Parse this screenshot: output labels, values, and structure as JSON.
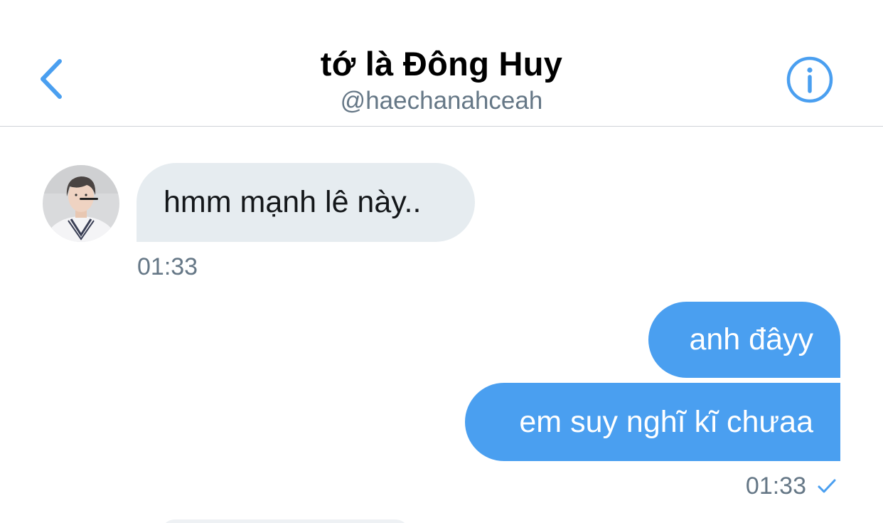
{
  "header": {
    "title": "tớ là Đông Huy",
    "handle": "@haechanahceah"
  },
  "messages": [
    {
      "direction": "incoming",
      "text": "hmm mạnh lê này..",
      "time": "01:33"
    },
    {
      "direction": "outgoing",
      "text": "anh đâyy"
    },
    {
      "direction": "outgoing",
      "text": "em suy nghĩ kĩ chưaa",
      "time": "01:33"
    }
  ],
  "colors": {
    "accent": "#4a9ff0",
    "incoming_bubble": "#e6ecf0",
    "secondary_text": "#657786"
  },
  "icons": {
    "back": "chevron-left-icon",
    "info": "info-circle-icon",
    "read_receipt": "check-icon"
  }
}
